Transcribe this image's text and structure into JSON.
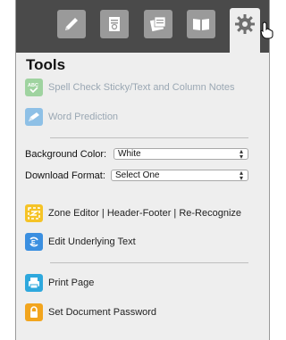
{
  "panel": {
    "title": "Tools",
    "tabs": [
      {
        "name": "pencil-icon"
      },
      {
        "name": "document-icon"
      },
      {
        "name": "sticky-notes-icon"
      },
      {
        "name": "book-icon"
      },
      {
        "name": "gear-icon",
        "active": true
      }
    ],
    "spell_check_label": "Spell Check Sticky/Text and Column Notes",
    "word_prediction_label": "Word Prediction",
    "background_color": {
      "label": "Background Color:",
      "value": "White"
    },
    "download_format": {
      "label": "Download Format:",
      "value": "Select One"
    },
    "zone_editor_label": "Zone Editor | Header-Footer | Re-Recognize",
    "edit_text_label": "Edit Underlying Text",
    "print_label": "Print Page",
    "password_label": "Set Document Password",
    "colors": {
      "tabbar": "#4a4a4a",
      "spell_icon": "#9fd3a0",
      "word_icon": "#8ec0e6",
      "zone_icon": "#f5c326",
      "edit_icon": "#3b8fe0",
      "print_icon": "#2ea8dd",
      "password_icon": "#f2a51e"
    }
  }
}
